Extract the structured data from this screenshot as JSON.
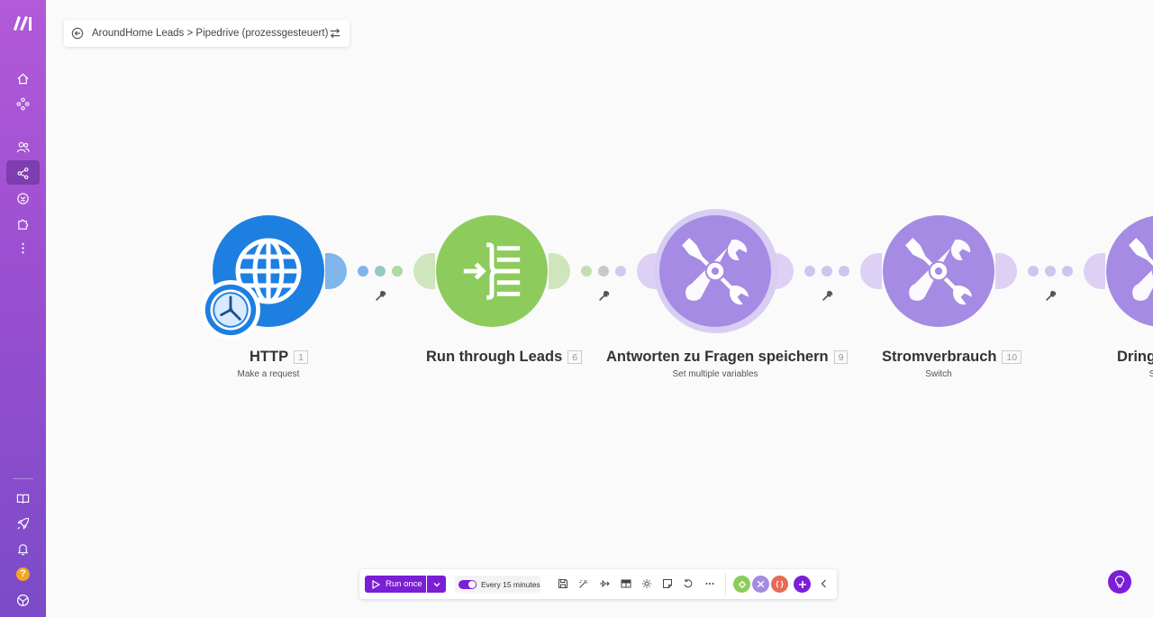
{
  "sidebar": {
    "logo": "make-logo",
    "items": [
      {
        "name": "home-icon"
      },
      {
        "name": "scenarios-graph-icon"
      },
      {
        "name": "team-icon"
      },
      {
        "name": "share-scenarios-icon"
      },
      {
        "name": "connections-icon"
      },
      {
        "name": "puzzle-icon"
      },
      {
        "name": "more-icon"
      },
      {
        "name": "book-icon"
      },
      {
        "name": "rocket-icon"
      },
      {
        "name": "bell-icon"
      },
      {
        "name": "help-icon",
        "label": "?"
      },
      {
        "name": "org-icon"
      }
    ]
  },
  "breadcrumb": {
    "text": "AroundHome Leads > Pipedrive (prozessgesteuert)"
  },
  "modules": [
    {
      "title": "HTTP",
      "num": "1",
      "subtitle": "Make a request",
      "color": "#1d7fe0",
      "icon": "globe-icon",
      "badge": "clock-icon"
    },
    {
      "title": "Run through Leads",
      "num": "6",
      "subtitle": "",
      "color": "#8dcc5c",
      "icon": "iterator-icon"
    },
    {
      "title": "Antworten zu Fragen speichern",
      "num": "9",
      "subtitle": "Set multiple variables",
      "color": "#a58be3",
      "icon": "tools-icon"
    },
    {
      "title": "Stromverbrauch",
      "num": "10",
      "subtitle": "Switch",
      "color": "#a58be3",
      "icon": "tools-icon"
    },
    {
      "title": "Dring",
      "num": "",
      "subtitle": "S",
      "color": "#a58be3",
      "icon": "tools-icon"
    }
  ],
  "toolbar": {
    "run_label": "Run once",
    "schedule_label": "Every 15 minutes",
    "accent": "#7a1fd6",
    "mini_apps": [
      {
        "name": "tools-app-green",
        "color": "#8dcc5c"
      },
      {
        "name": "tools-app-purple",
        "color": "#a58be3"
      },
      {
        "name": "tools-app-orange",
        "color": "#e96a55",
        "label": "{ }"
      }
    ]
  }
}
